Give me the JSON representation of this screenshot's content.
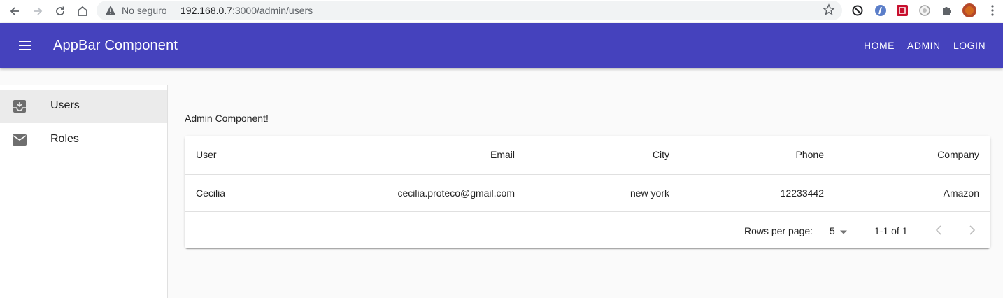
{
  "browser": {
    "status": "No seguro",
    "url_host": "192.168.0.7",
    "url_path": ":3000/admin/users"
  },
  "appbar": {
    "title": "AppBar Component",
    "links": [
      "HOME",
      "ADMIN",
      "LOGIN"
    ],
    "color": "#4542bd"
  },
  "sidebar": {
    "items": [
      {
        "label": "Users",
        "icon": "inbox-icon"
      },
      {
        "label": "Roles",
        "icon": "mail-icon"
      }
    ]
  },
  "main": {
    "title": "Admin Component!",
    "table": {
      "columns": [
        "User",
        "Email",
        "City",
        "Phone",
        "Company"
      ],
      "rows": [
        [
          "Cecilia",
          "cecilia.proteco@gmail.com",
          "new york",
          "12233442",
          "Amazon"
        ]
      ],
      "rows_per_page_label": "Rows per page:",
      "rows_per_page_value": "5",
      "range_text": "1-1 of 1"
    }
  }
}
